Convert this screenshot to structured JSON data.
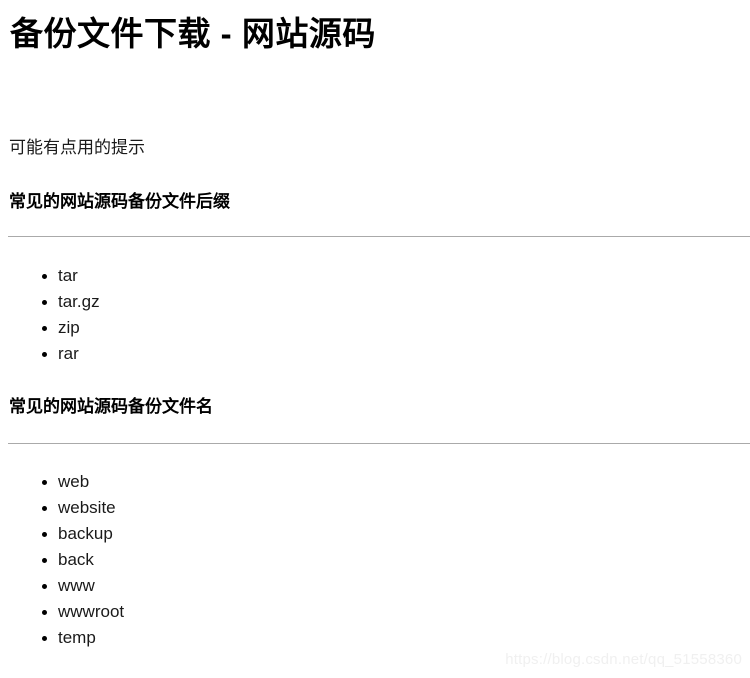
{
  "document": {
    "title": "备份文件下载 - 网站源码",
    "intro": "可能有点用的提示",
    "sections": [
      {
        "heading": "常见的网站源码备份文件后缀",
        "items": [
          "tar",
          "tar.gz",
          "zip",
          "rar"
        ]
      },
      {
        "heading": "常见的网站源码备份文件名",
        "items": [
          "web",
          "website",
          "backup",
          "back",
          "www",
          "wwwroot",
          "temp"
        ]
      }
    ]
  },
  "watermark": {
    "text": "https://blog.csdn.net/qq_51558360"
  },
  "colors": {
    "background": "#ffffff",
    "text": "#24292e",
    "heading": "#000000",
    "rule": "#aaaaaa",
    "watermark": "#f0f0f0"
  }
}
